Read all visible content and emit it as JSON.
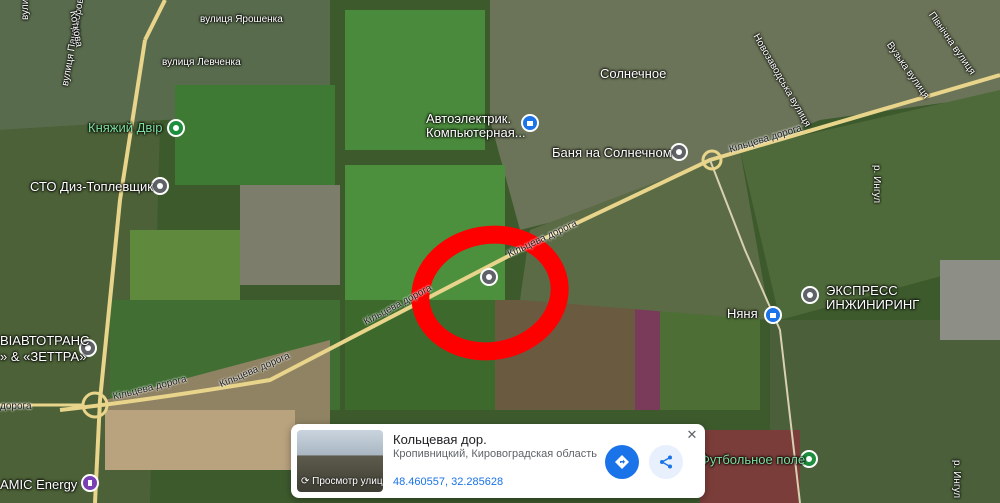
{
  "map": {
    "labels": {
      "yaroshenka": "вулиця Ярошенка",
      "levchenka": "вулиця Левченка",
      "sutkovetska": "вулиця Сутковецька",
      "panfiorova": "вулиця Панфьорова",
      "kotkova": "Коткова",
      "solnechnoe": "Солнечное",
      "novozavodska": "Новозаводська вулиця",
      "vuzhna": "Вузька вулиця",
      "pivnichna": "Північна вулиця",
      "road_1": "Кільцева дорога",
      "road_2": "Кільцева дорога",
      "road_3": "Кільцева дорога",
      "road_4": "Кільцева дорога",
      "road_5": "Кільцева дорога",
      "road_6": "дорога",
      "river_1": "р. Ингул",
      "river_2": "р. Ингул"
    },
    "poi": {
      "knyazhiy": "Княжий Двір",
      "sto": "СТО Диз-Топлевщик",
      "autoelectric_1": "Автоэлектрик.",
      "autoelectric_2": "Компьютерная...",
      "banya": "Баня на Солнечном",
      "express_1": "ЭКСПРЕСС",
      "express_2": "ИНЖИНИРИНГ",
      "nyanya": "Няня",
      "avtotrans_1": "ВІАВТОТРАНС",
      "avtotrans_2": "» & «ЗЕТТРА»",
      "amic": "АМІС Energy",
      "football": "Футбольное поле"
    }
  },
  "card": {
    "title": "Кольцевая дор.",
    "subtitle": "Кропивницкий, Кировоградская область",
    "coords": "48.460557, 32.285628",
    "street_view": "Просмотр улиц",
    "close": "✕"
  },
  "colors": {
    "circle": "#ff0000",
    "road": "#e8d48a",
    "directions": "#1a73e8",
    "poi_green": "#1e8e3e"
  }
}
